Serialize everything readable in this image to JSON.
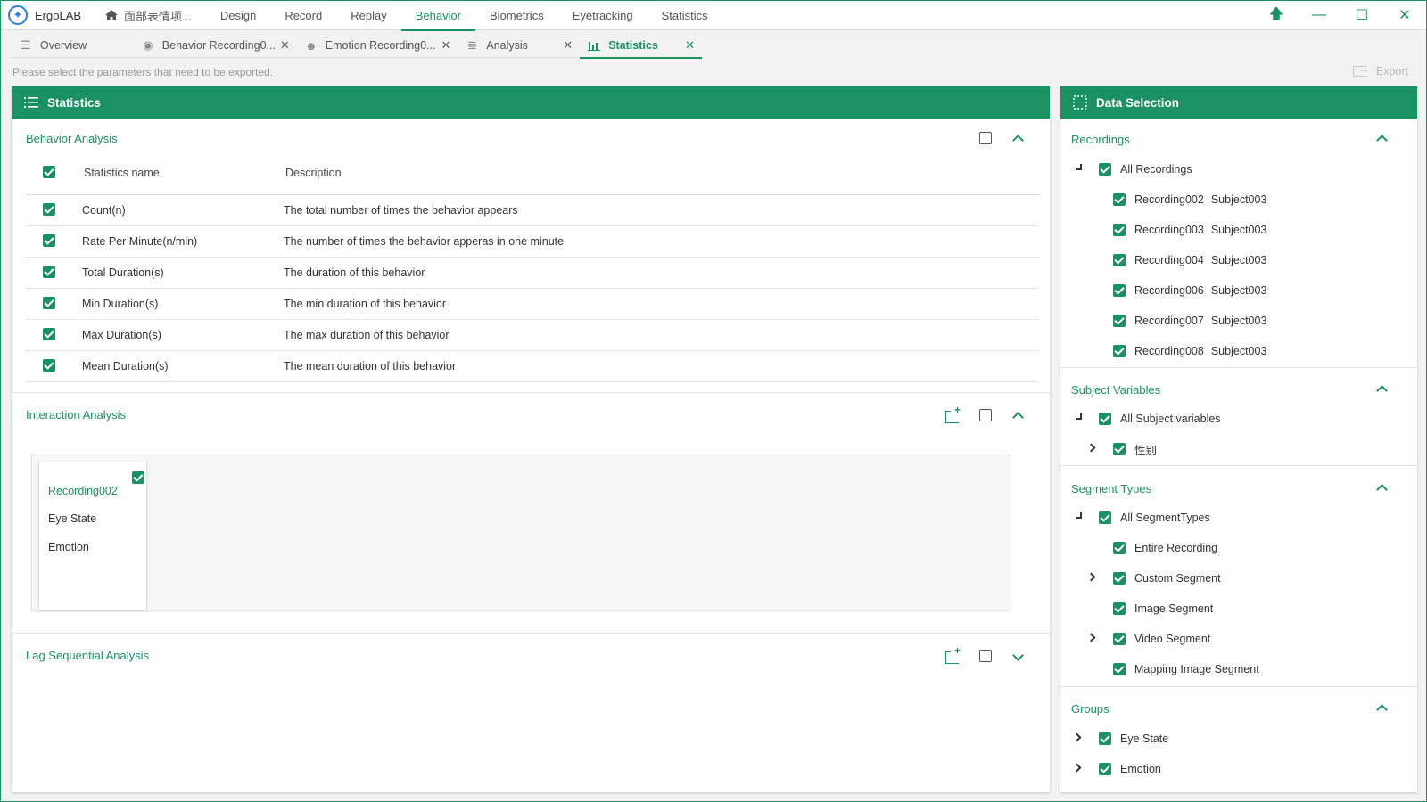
{
  "app": {
    "name": "ErgoLAB"
  },
  "menu": {
    "home_label": "面部表情项...",
    "items": [
      "Design",
      "Record",
      "Replay",
      "Behavior",
      "Biometrics",
      "Eyetracking",
      "Statistics"
    ],
    "active": "Behavior"
  },
  "window_controls": {
    "pin": "🡅",
    "minimize": "—",
    "maximize": "☐",
    "close": "✕"
  },
  "tabs": [
    {
      "label": "Overview",
      "icon": "overview-icon",
      "closable": false
    },
    {
      "label": "Behavior Recording0...",
      "icon": "behavior-icon",
      "closable": true
    },
    {
      "label": "Emotion Recording0...",
      "icon": "emotion-icon",
      "closable": true
    },
    {
      "label": "Analysis",
      "icon": "analysis-icon",
      "closable": true
    },
    {
      "label": "Statistics",
      "icon": "statistics-icon",
      "closable": true,
      "active": true
    }
  ],
  "hint": "Please select the parameters that need to be exported.",
  "export_label": "Export",
  "left_panel": {
    "title": "Statistics",
    "behavior": {
      "title": "Behavior Analysis",
      "col_name": "Statistics name",
      "col_desc": "Description",
      "rows": [
        {
          "name": "Count(n)",
          "desc": "The total number of times the behavior appears"
        },
        {
          "name": "Rate Per Minute(n/min)",
          "desc": "The number of times the behavior apperas in one minute"
        },
        {
          "name": "Total Duration(s)",
          "desc": "The duration of this behavior"
        },
        {
          "name": "Min Duration(s)",
          "desc": "The min duration of this behavior"
        },
        {
          "name": "Max Duration(s)",
          "desc": "The max duration of this behavior"
        },
        {
          "name": "Mean Duration(s)",
          "desc": "The mean duration of this behavior"
        }
      ]
    },
    "interaction": {
      "title": "Interaction Analysis",
      "card": {
        "title": "Recording002",
        "items": [
          "Eye State",
          "Emotion"
        ]
      }
    },
    "lag": {
      "title": "Lag Sequential Analysis"
    }
  },
  "right_panel": {
    "title": "Data Selection",
    "recordings": {
      "title": "Recordings",
      "all": "All Recordings",
      "items": [
        {
          "rec": "Recording002",
          "subject": "Subject003"
        },
        {
          "rec": "Recording003",
          "subject": "Subject003"
        },
        {
          "rec": "Recording004",
          "subject": "Subject003"
        },
        {
          "rec": "Recording006",
          "subject": "Subject003"
        },
        {
          "rec": "Recording007",
          "subject": "Subject003"
        },
        {
          "rec": "Recording008",
          "subject": "Subject003"
        }
      ]
    },
    "subject_vars": {
      "title": "Subject Variables",
      "all": "All Subject variables",
      "items": [
        "性别"
      ]
    },
    "segment_types": {
      "title": "Segment Types",
      "all": "All SegmentTypes",
      "items": [
        "Entire Recording",
        "Custom Segment",
        "Image Segment",
        "Video Segment",
        "Mapping Image Segment"
      ]
    },
    "groups": {
      "title": "Groups",
      "items": [
        "Eye State",
        "Emotion"
      ]
    }
  },
  "colors": {
    "accent": "#1a9162",
    "background": "#f2f2f2"
  }
}
